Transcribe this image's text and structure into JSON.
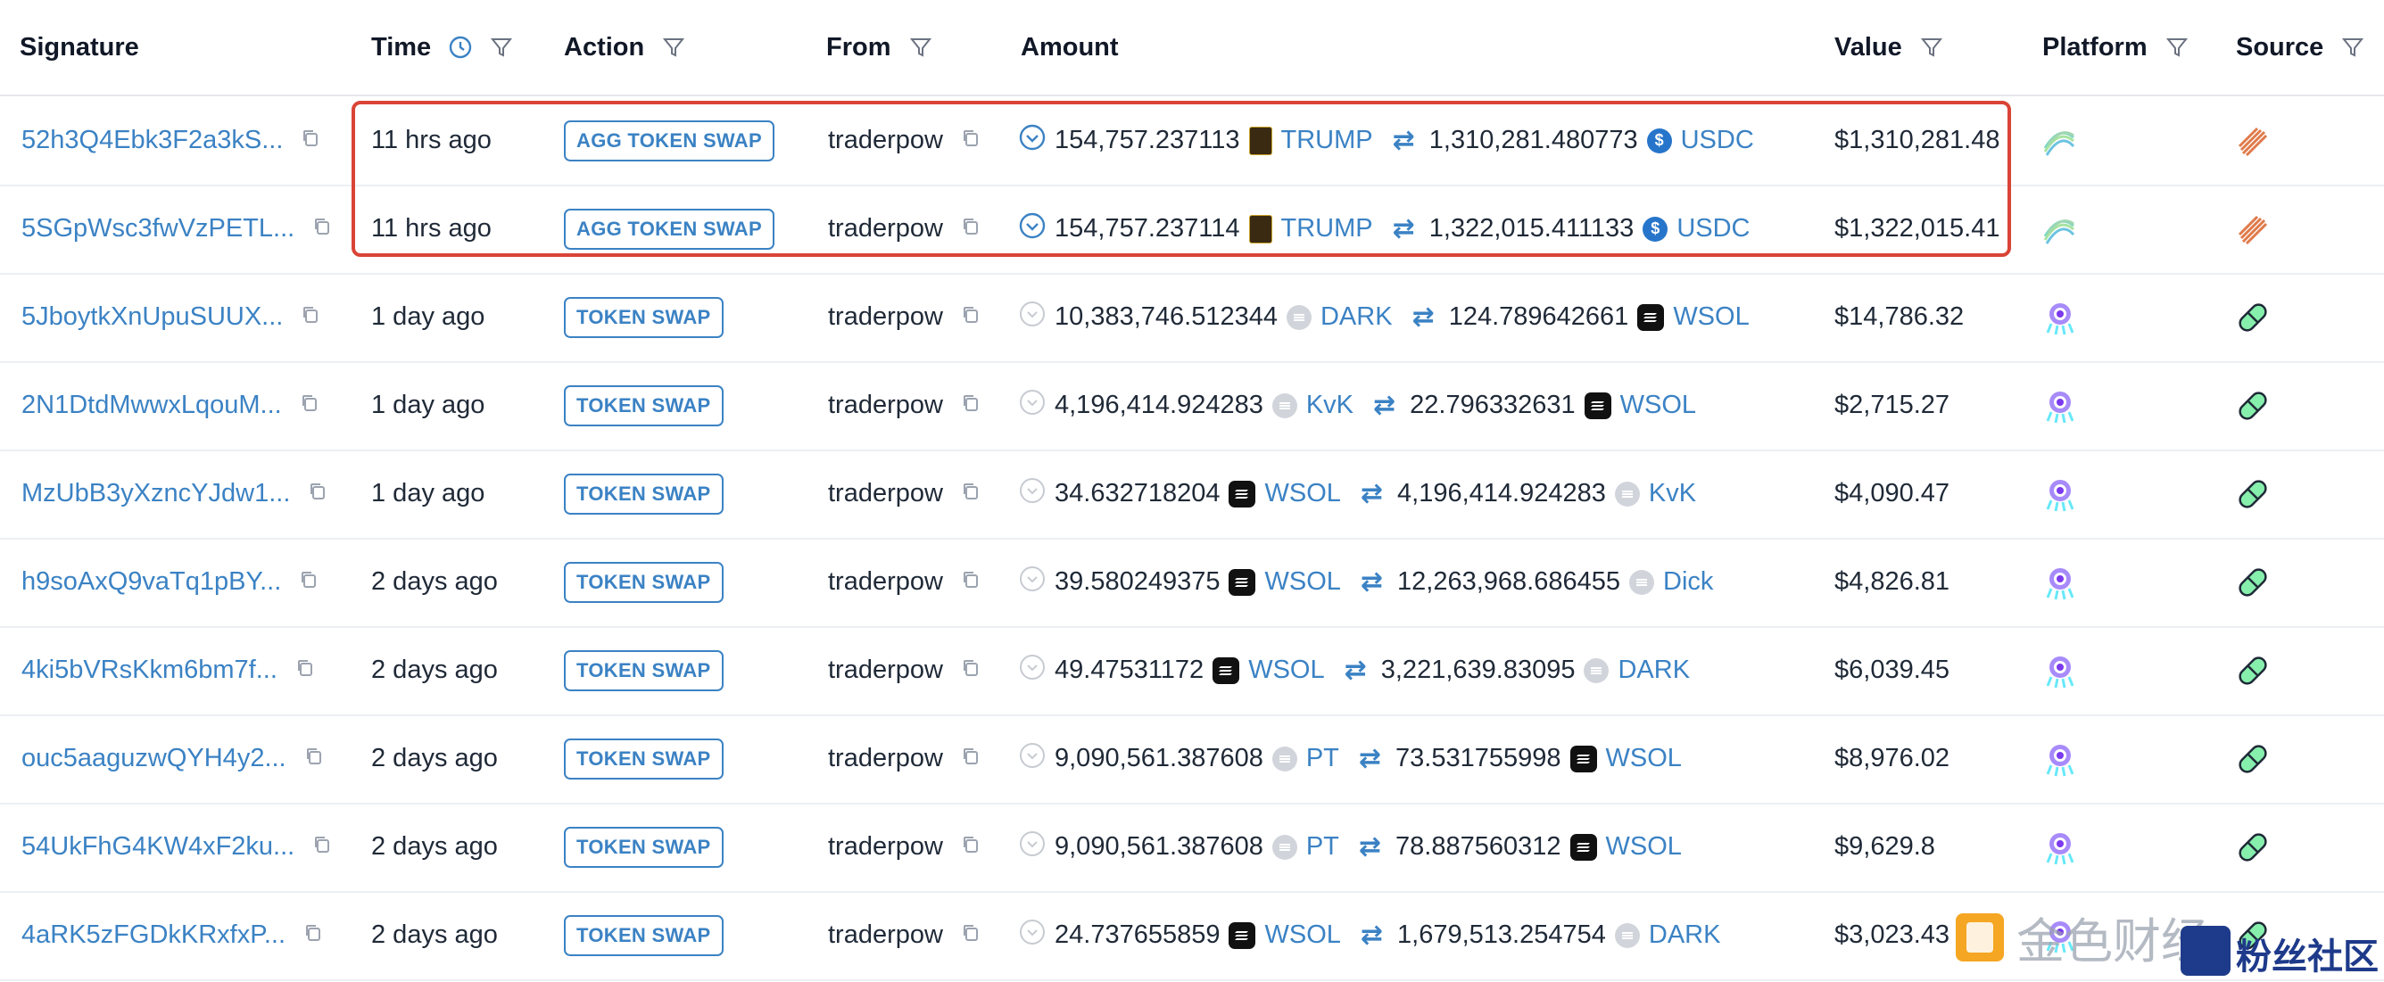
{
  "headers": {
    "signature": "Signature",
    "time": "Time",
    "action": "Action",
    "from": "From",
    "amount": "Amount",
    "value": "Value",
    "platform": "Platform",
    "source": "Source"
  },
  "rows": [
    {
      "signature": "52h3Q4Ebk3F2a3kS...",
      "time": "11 hrs ago",
      "action": "AGG TOKEN SWAP",
      "from": "traderpow",
      "in_amount": "154,757.237113",
      "in_symbol": "TRUMP",
      "out_amount": "1,310,281.480773",
      "out_symbol": "USDC",
      "value": "$1,310,281.48"
    },
    {
      "signature": "5SGpWsc3fwVzPETL...",
      "time": "11 hrs ago",
      "action": "AGG TOKEN SWAP",
      "from": "traderpow",
      "in_amount": "154,757.237114",
      "in_symbol": "TRUMP",
      "out_amount": "1,322,015.411133",
      "out_symbol": "USDC",
      "value": "$1,322,015.41"
    },
    {
      "signature": "5JboytkXnUpuSUUX...",
      "time": "1 day ago",
      "action": "TOKEN SWAP",
      "from": "traderpow",
      "in_amount": "10,383,746.512344",
      "in_symbol": "DARK",
      "out_amount": "124.789642661",
      "out_symbol": "WSOL",
      "value": "$14,786.32"
    },
    {
      "signature": "2N1DtdMwwxLqouM...",
      "time": "1 day ago",
      "action": "TOKEN SWAP",
      "from": "traderpow",
      "in_amount": "4,196,414.924283",
      "in_symbol": "KvK",
      "out_amount": "22.796332631",
      "out_symbol": "WSOL",
      "value": "$2,715.27"
    },
    {
      "signature": "MzUbB3yXzncYJdw1...",
      "time": "1 day ago",
      "action": "TOKEN SWAP",
      "from": "traderpow",
      "in_amount": "34.632718204",
      "in_symbol": "WSOL",
      "out_amount": "4,196,414.924283",
      "out_symbol": "KvK",
      "value": "$4,090.47"
    },
    {
      "signature": "h9soAxQ9vaTq1pBY...",
      "time": "2 days ago",
      "action": "TOKEN SWAP",
      "from": "traderpow",
      "in_amount": "39.580249375",
      "in_symbol": "WSOL",
      "out_amount": "12,263,968.686455",
      "out_symbol": "Dick",
      "value": "$4,826.81"
    },
    {
      "signature": "4ki5bVRsKkm6bm7f...",
      "time": "2 days ago",
      "action": "TOKEN SWAP",
      "from": "traderpow",
      "in_amount": "49.47531172",
      "in_symbol": "WSOL",
      "out_amount": "3,221,639.83095",
      "out_symbol": "DARK",
      "value": "$6,039.45"
    },
    {
      "signature": "ouc5aaguzwQYH4y2...",
      "time": "2 days ago",
      "action": "TOKEN SWAP",
      "from": "traderpow",
      "in_amount": "9,090,561.387608",
      "in_symbol": "PT",
      "out_amount": "73.531755998",
      "out_symbol": "WSOL",
      "value": "$8,976.02"
    },
    {
      "signature": "54UkFhG4KW4xF2ku...",
      "time": "2 days ago",
      "action": "TOKEN SWAP",
      "from": "traderpow",
      "in_amount": "9,090,561.387608",
      "in_symbol": "PT",
      "out_amount": "78.887560312",
      "out_symbol": "WSOL",
      "value": "$9,629.8"
    },
    {
      "signature": "4aRK5zFGDkKRxfxP...",
      "time": "2 days ago",
      "action": "TOKEN SWAP",
      "from": "traderpow",
      "in_amount": "24.737655859",
      "in_symbol": "WSOL",
      "out_amount": "1,679,513.254754",
      "out_symbol": "DARK",
      "value": "$3,023.43"
    }
  ],
  "watermark": {
    "text": "金色财经",
    "sub": "粉丝社区"
  },
  "colors": {
    "link": "#3b82c4",
    "highlight": "#d94436"
  }
}
